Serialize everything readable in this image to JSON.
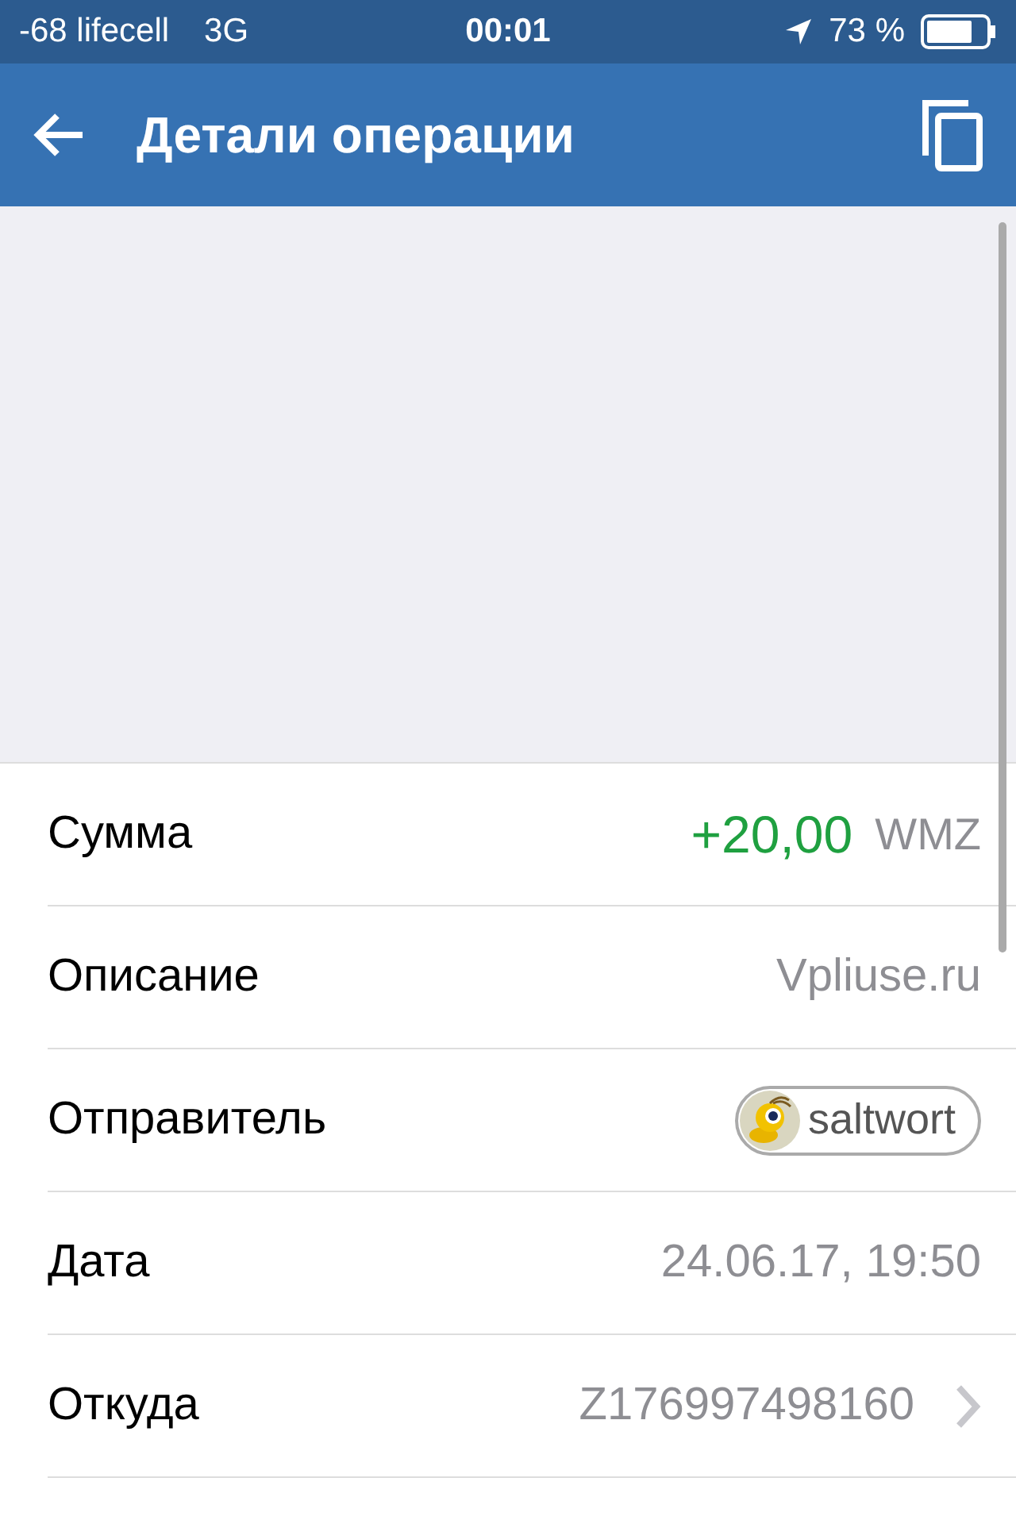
{
  "status_bar": {
    "carrier": "-68 lifecell",
    "network": "3G",
    "time": "00:01",
    "battery": "73 %"
  },
  "header": {
    "title": "Детали операции"
  },
  "rows": [
    {
      "kind": "amount",
      "label": "Сумма",
      "value": "+20,00",
      "currency": "WMZ"
    },
    {
      "kind": "text",
      "label": "Описание",
      "value": "Vpliuse.ru"
    },
    {
      "kind": "user",
      "label": "Отправитель",
      "value": "saltwort"
    },
    {
      "kind": "text",
      "label": "Дата",
      "value": "24.06.17, 19:50"
    },
    {
      "kind": "link",
      "label": "Откуда",
      "value": "Z176997498160"
    }
  ]
}
